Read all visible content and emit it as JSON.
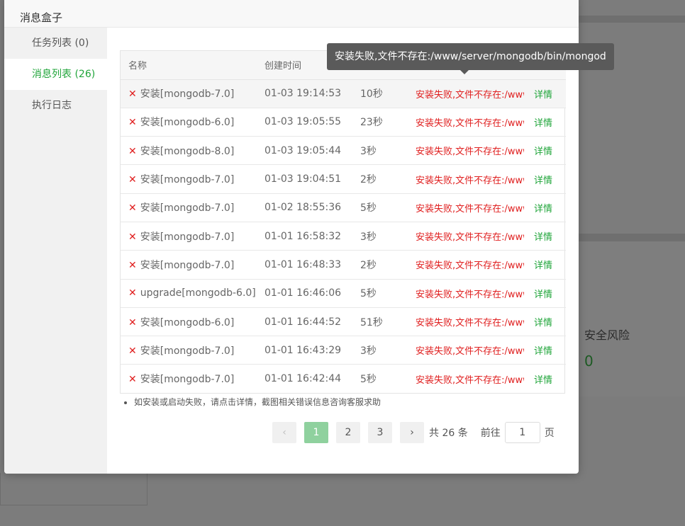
{
  "modal": {
    "title": "消息盒子"
  },
  "sidebar": {
    "items": [
      {
        "label": "任务列表 (0)"
      },
      {
        "label": "消息列表 (26)"
      },
      {
        "label": "执行日志"
      }
    ]
  },
  "table": {
    "headers": {
      "name": "名称",
      "created": "创建时间"
    },
    "detail_label": "详情",
    "rows": [
      {
        "name": "安装[mongodb-7.0]",
        "time": "01-03 19:14:53",
        "duration": "10秒",
        "status": "安装失败,文件不存在:/www/server/mongodb/bin/mongod"
      },
      {
        "name": "安装[mongodb-6.0]",
        "time": "01-03 19:05:55",
        "duration": "23秒",
        "status": "安装失败,文件不存在:/www/server/mongodb/bin/mongod"
      },
      {
        "name": "安装[mongodb-8.0]",
        "time": "01-03 19:05:44",
        "duration": "3秒",
        "status": "安装失败,文件不存在:/www/server/mongodb/bin/mongod"
      },
      {
        "name": "安装[mongodb-7.0]",
        "time": "01-03 19:04:51",
        "duration": "2秒",
        "status": "安装失败,文件不存在:/www/server/mongodb/bin/mongod"
      },
      {
        "name": "安装[mongodb-7.0]",
        "time": "01-02 18:55:36",
        "duration": "5秒",
        "status": "安装失败,文件不存在:/www/server/mongodb/bin/mongod"
      },
      {
        "name": "安装[mongodb-7.0]",
        "time": "01-01 16:58:32",
        "duration": "3秒",
        "status": "安装失败,文件不存在:/www/server/mongodb/bin/mongod"
      },
      {
        "name": "安装[mongodb-7.0]",
        "time": "01-01 16:48:33",
        "duration": "2秒",
        "status": "安装失败,文件不存在:/www/server/mongodb/bin/mongod"
      },
      {
        "name": "upgrade[mongodb-6.0]",
        "time": "01-01 16:46:06",
        "duration": "5秒",
        "status": "安装失败,文件不存在:/www/server/mongodb/bin/mongod"
      },
      {
        "name": "安装[mongodb-6.0]",
        "time": "01-01 16:44:52",
        "duration": "51秒",
        "status": "安装失败,文件不存在:/www/server/mongodb/bin/mongod"
      },
      {
        "name": "安装[mongodb-7.0]",
        "time": "01-01 16:43:29",
        "duration": "3秒",
        "status": "安装失败,文件不存在:/www/server/mongodb/bin/mongod"
      },
      {
        "name": "安装[mongodb-7.0]",
        "time": "01-01 16:42:44",
        "duration": "5秒",
        "status": "安装失败,文件不存在:/www/server/mongodb/bin/mongod"
      }
    ]
  },
  "note": "如安装或启动失败，请点击详情，截图相关错误信息咨询客服求助",
  "pagination": {
    "prev": "‹",
    "next": "›",
    "pages": [
      "1",
      "2",
      "3"
    ],
    "current": "1",
    "total": "共 26 条",
    "goto": "前往",
    "goto_value": "1",
    "unit": "页"
  },
  "tooltip": "安装失败,文件不存在:/www/server/mongodb/bin/mongod",
  "background": {
    "risk_label": "安全风险",
    "risk_value": "0"
  },
  "colors": {
    "accent": "#20a53a",
    "error": "#e02020"
  }
}
